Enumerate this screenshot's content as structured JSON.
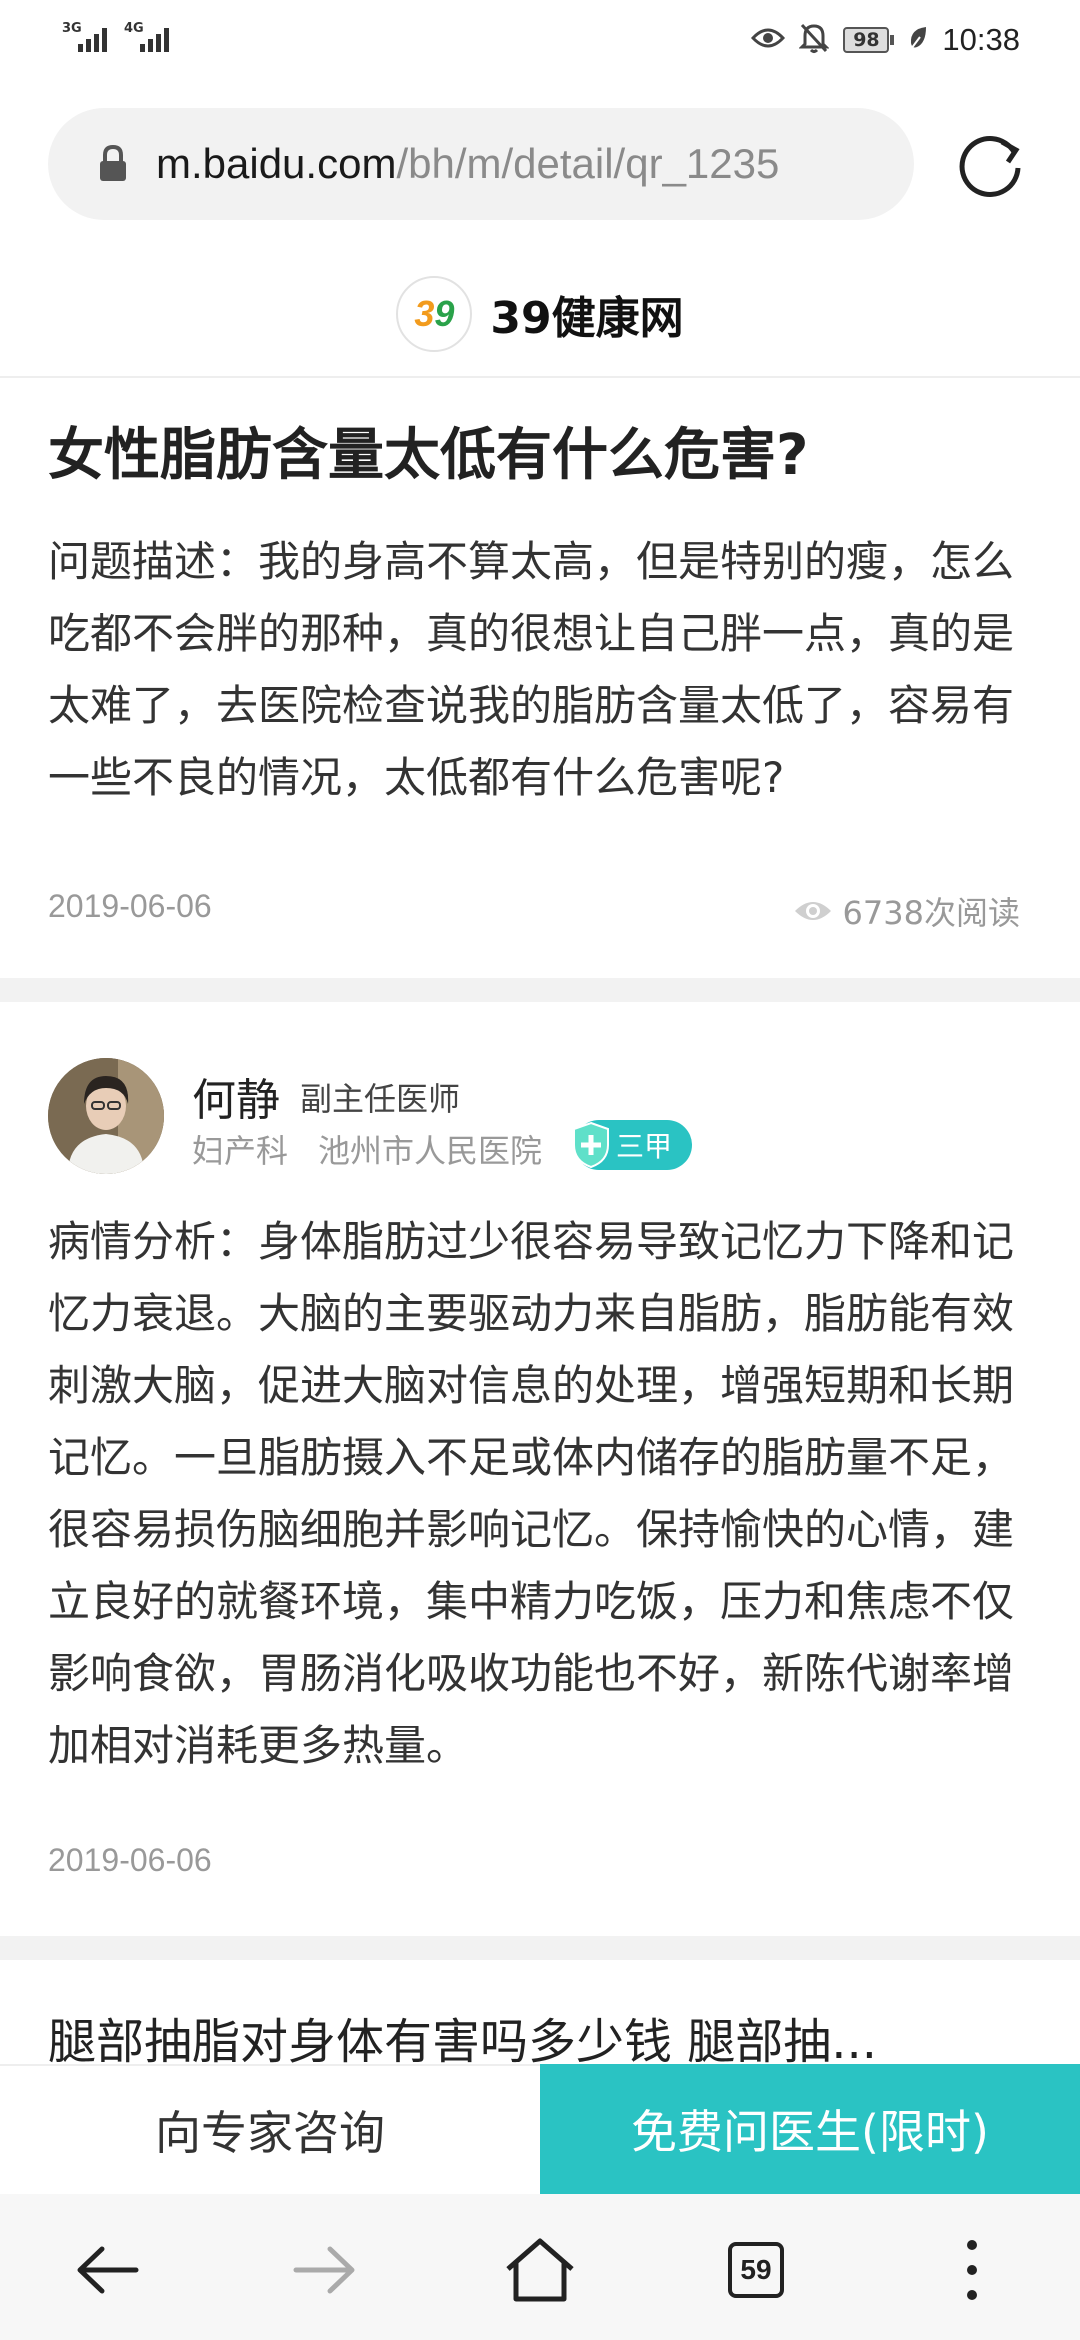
{
  "status": {
    "sim1": "3G",
    "sim2": "4G",
    "battery": "98",
    "time": "10:38"
  },
  "browser": {
    "url_host": "m.baidu.com",
    "url_path": "/bh/m/detail/qr_1235"
  },
  "site": {
    "name": "39健康网",
    "logo_text": "39"
  },
  "question": {
    "title": "女性脂肪含量太低有什么危害?",
    "description": "问题描述：我的身高不算太高，但是特别的瘦，怎么吃都不会胖的那种，真的很想让自己胖一点，真的是太难了，去医院检查说我的脂肪含量太低了，容易有一些不良的情况，太低都有什么危害呢?",
    "date": "2019-06-06",
    "views": "6738次阅读"
  },
  "answer": {
    "doctor_name": "何静",
    "doctor_title": "副主任医师",
    "department": "妇产科",
    "hospital": "池州市人民医院",
    "hospital_grade": "三甲",
    "text": "病情分析：身体脂肪过少很容易导致记忆力下降和记忆力衰退。大脑的主要驱动力来自脂肪，脂肪能有效刺激大脑，促进大脑对信息的处理，增强短期和长期记忆。一旦脂肪摄入不足或体内储存的脂肪量不足，很容易损伤脑细胞并影响记忆。保持愉快的心情，建立良好的就餐环境，集中精力吃饭，压力和焦虑不仅影响食欲，胃肠消化吸收功能也不好，新陈代谢率增加相对消耗更多热量。",
    "date": "2019-06-06"
  },
  "next_article": {
    "title": "腿部抽脂对身体有害吗多少钱 腿部抽..."
  },
  "actions": {
    "consult_label": "向专家咨询",
    "ask_label": "免费问医生(限时)"
  },
  "nav": {
    "tab_count": "59"
  },
  "colors": {
    "accent": "#2ac3c3",
    "logo_orange": "#f29b1d",
    "logo_green": "#2aa24a"
  }
}
